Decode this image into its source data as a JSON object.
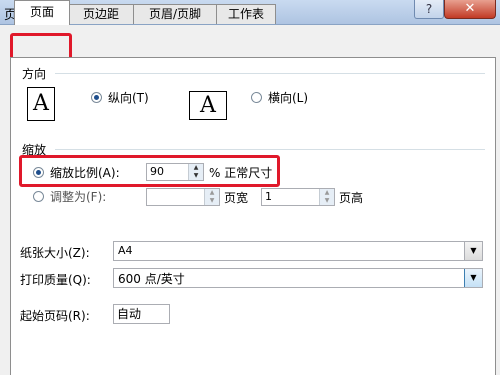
{
  "window": {
    "title": "页面设置",
    "help_glyph": "?",
    "close_glyph": "✕"
  },
  "tabs": [
    "页面",
    "页边距",
    "页眉/页脚",
    "工作表"
  ],
  "orientation": {
    "group_label": "方向",
    "portrait_label": "纵向(T)",
    "landscape_label": "横向(L)",
    "icon_glyph": "A",
    "selected": "portrait"
  },
  "scaling": {
    "group_label": "缩放",
    "adjust_label": "缩放比例(A):",
    "adjust_value": "90",
    "adjust_suffix": "% 正常尺寸",
    "fit_label": "调整为(F):",
    "fit_wide_value": "",
    "fit_wide_suffix": "页宽",
    "fit_tall_value": "1",
    "fit_tall_suffix": "页高",
    "selected": "adjust"
  },
  "paper_size": {
    "label": "纸张大小(Z):",
    "value": "A4"
  },
  "print_quality": {
    "label": "打印质量(Q):",
    "value": "600 点/英寸"
  },
  "first_page": {
    "label": "起始页码(R):",
    "value": "自动"
  },
  "glyphs": {
    "spin_up": "▲",
    "spin_down": "▼",
    "dropdown": "▼"
  },
  "colors": {
    "highlight": "#e0182a",
    "title_bar": "#b9cde8",
    "close": "#c23a25"
  }
}
